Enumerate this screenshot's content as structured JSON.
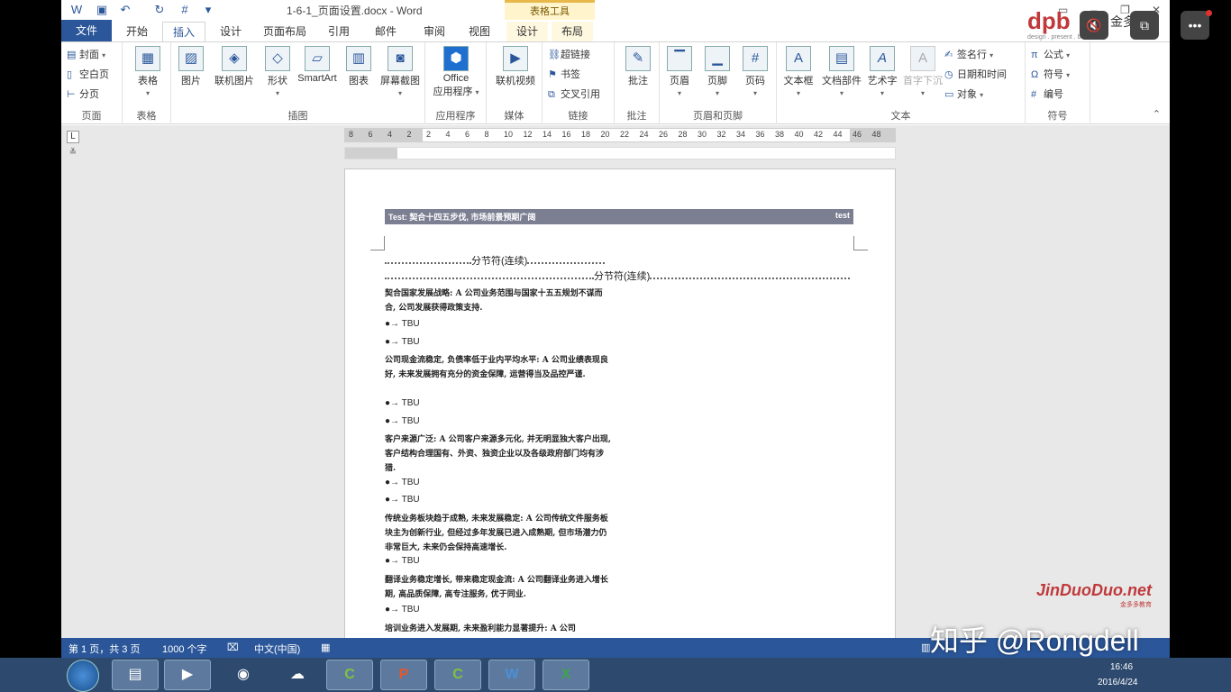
{
  "window": {
    "title": "1-6-1_页面设置.docx - Word",
    "context_tab_title": "表格工具"
  },
  "tabs": [
    {
      "label": "文件"
    },
    {
      "label": "开始"
    },
    {
      "label": "插入"
    },
    {
      "label": "设计"
    },
    {
      "label": "页面布局"
    },
    {
      "label": "引用"
    },
    {
      "label": "邮件"
    },
    {
      "label": "审阅"
    },
    {
      "label": "视图"
    },
    {
      "label": "设计"
    },
    {
      "label": "布局"
    }
  ],
  "active_tab": "插入",
  "ribbon": {
    "pages": {
      "group": "页面",
      "cover": "封面",
      "blank": "空白页",
      "break": "分页"
    },
    "tables": {
      "group": "表格",
      "table": "表格"
    },
    "illustrations": {
      "group": "插图",
      "picture": "图片",
      "online_picture": "联机图片",
      "shapes": "形状",
      "smartart": "SmartArt",
      "chart": "图表",
      "screenshot": "屏幕截图"
    },
    "apps": {
      "group": "应用程序",
      "office_apps_1": "Office",
      "office_apps_2": "应用程序"
    },
    "media": {
      "group": "媒体",
      "online_video": "联机视频"
    },
    "links": {
      "group": "链接",
      "hyperlink": "超链接",
      "bookmark": "书签",
      "cross_ref": "交叉引用"
    },
    "comments": {
      "group": "批注",
      "comment": "批注"
    },
    "header_footer": {
      "group": "页眉和页脚",
      "header": "页眉",
      "footer": "页脚",
      "page_number": "页码"
    },
    "text": {
      "group": "文本",
      "textbox": "文本框",
      "quick_parts": "文档部件",
      "wordart": "艺术字",
      "dropcap": "首字下沉",
      "signature": "签名行",
      "datetime": "日期和时间",
      "object": "对象"
    },
    "symbols": {
      "group": "符号",
      "equation": "公式",
      "symbol": "符号",
      "number": "编号"
    }
  },
  "ruler": {
    "ticks": [
      "8",
      "6",
      "4",
      "2",
      "2",
      "4",
      "6",
      "8",
      "10",
      "12",
      "14",
      "16",
      "18",
      "20",
      "22",
      "24",
      "26",
      "28",
      "30",
      "32",
      "34",
      "36",
      "38",
      "40",
      "42",
      "44",
      "46",
      "48"
    ]
  },
  "document": {
    "header_left": "Test: 契合十四五步伐, 市场前景预期广阔",
    "header_right": "test",
    "section_break_1": "分节符(连续)",
    "section_break_2": "分节符(连续)",
    "paragraphs": [
      "契合国家发展战略: A 公司业务范围与国家十五五规划不谋而合, 公司发展获得政策支持.",
      "公司现金流稳定, 负债率低于业内平均水平: A 公司业绩表现良好, 未来发展拥有充分的资金保障, 运营得当及品控严谨.",
      "客户来源广泛: A 公司客户来源多元化, 并无明显独大客户出现, 客户结构合理国有、外资、独资企业以及各级政府部门均有涉猎.",
      "传统业务板块趋于成熟, 未来发展稳定: A 公司传统文件服务板块主为创新行业, 但经过多年发展已进入成熟期, 但市场潜力仍非常巨大, 未来仍会保持高速增长.",
      "翻译业务稳定增长, 带来稳定现金流: A 公司翻译业务进入增长期, 高品质保障, 高专注服务, 优于同业.",
      "培训业务进入发展期, 未来盈利能力显著提升: A 公司"
    ],
    "bullet_text": "TBU"
  },
  "statusbar": {
    "page": "第 1 页，共 3 页",
    "words": "1000 个字",
    "language": "中文(中国)"
  },
  "watermarks": {
    "dpb": "dpb",
    "dpb_small": "design . present . business",
    "dpb_cn": "金多多",
    "jdd": "JinDuoDuo.net",
    "jdd_cn": "金多多教育",
    "zhihu": "知乎 @Rongdell"
  },
  "taskbar": {
    "apps": [
      "Explorer",
      "Player",
      "Chrome",
      "Cloud",
      "Camtasia",
      "PowerPoint",
      "Camtasia Recorder",
      "Word",
      "Excel"
    ],
    "time": "16:46",
    "date": "2016/4/24"
  },
  "colors": {
    "word_blue": "#2b579a",
    "header_bar": "#7c7f92",
    "logo_red": "#c0393b",
    "taskbar": "#2d4a6e"
  }
}
